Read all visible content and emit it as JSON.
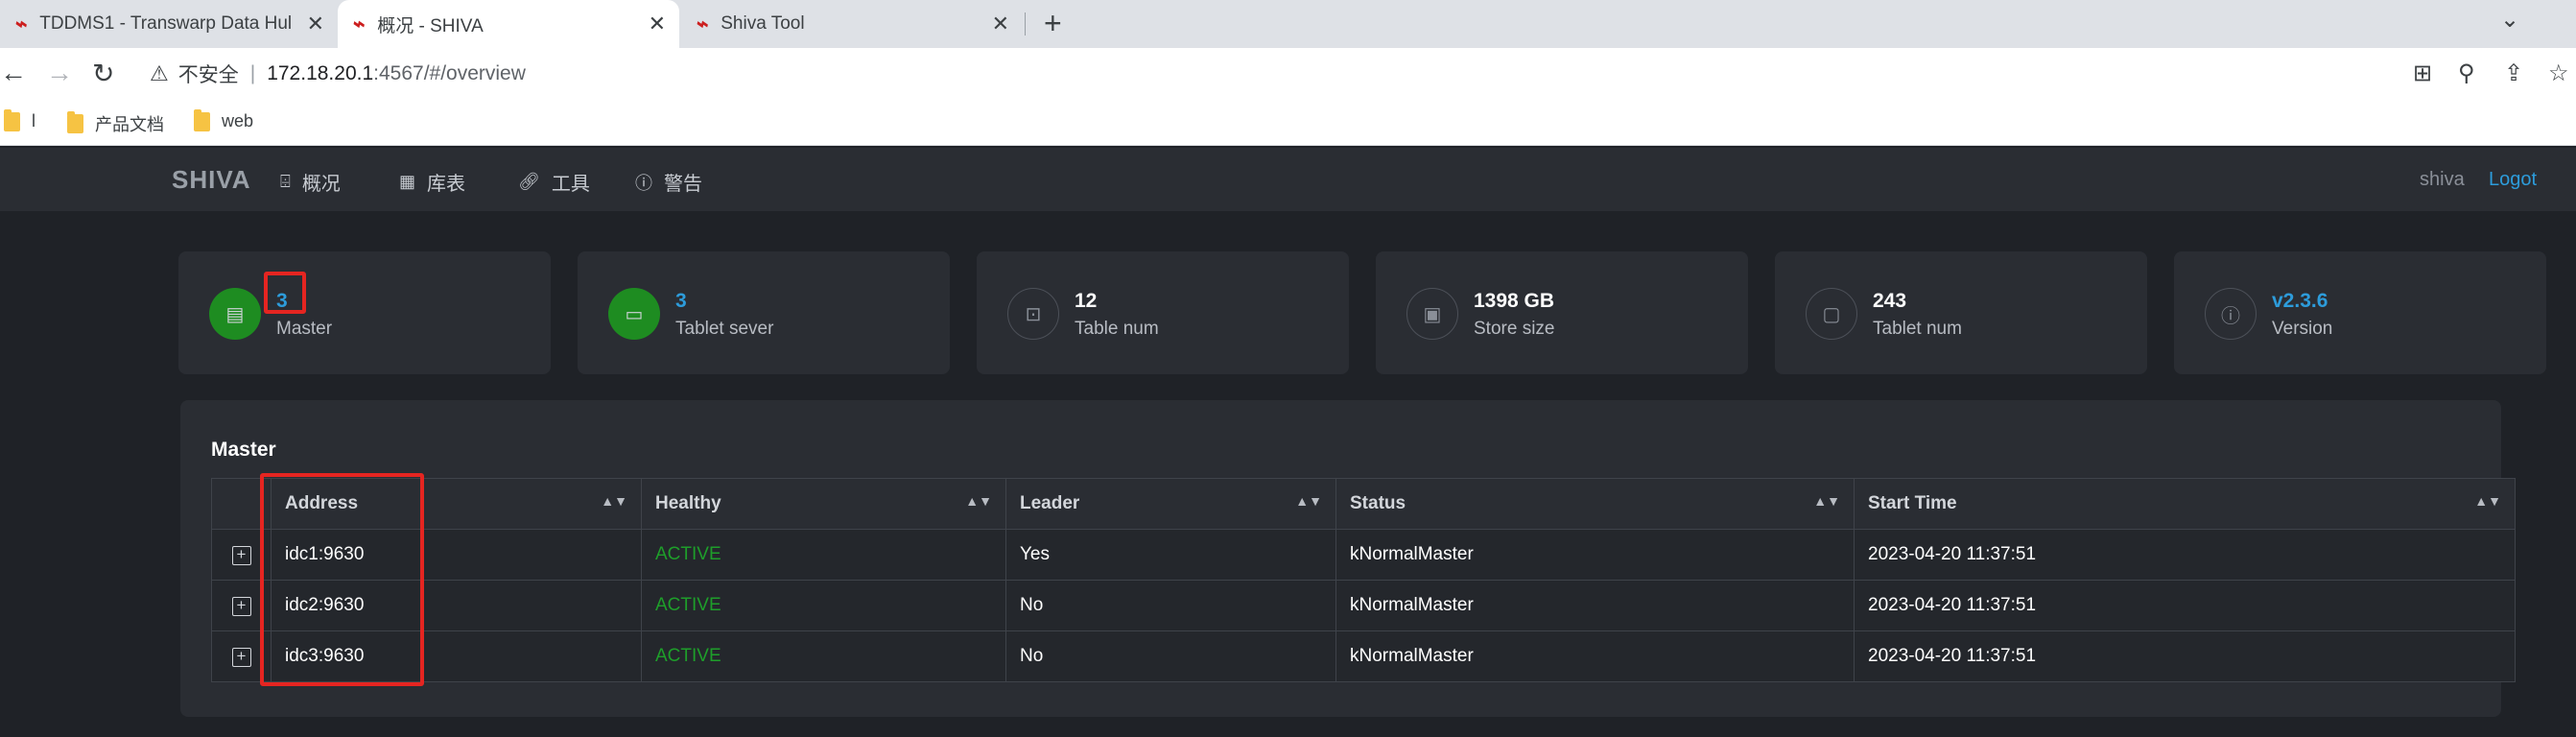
{
  "browser": {
    "tabs": [
      {
        "title": "TDDMS1 - Transwarp Data Hul"
      },
      {
        "title": "概况 - SHIVA"
      },
      {
        "title": "Shiva Tool"
      }
    ],
    "newtab": "+",
    "address": {
      "insecure_label": "不安全",
      "host": "172.18.20.1",
      "path": ":4567/#/overview"
    },
    "bookmarks": [
      {
        "label": "l"
      },
      {
        "label": "产品文档"
      },
      {
        "label": "web"
      }
    ]
  },
  "app": {
    "brand": "SHIVA",
    "menu": [
      {
        "label": "概况",
        "icon": "dashboard-icon"
      },
      {
        "label": "库表",
        "icon": "grid-icon"
      },
      {
        "label": "工具",
        "icon": "link-icon"
      },
      {
        "label": "警告",
        "icon": "info-icon"
      }
    ],
    "user": "shiva",
    "logout": "Logot"
  },
  "cards": [
    {
      "value": "3",
      "label": "Master",
      "icon": "server-icon"
    },
    {
      "value": "3",
      "label": "Tablet sever",
      "icon": "monitor-icon"
    },
    {
      "value": "12",
      "label": "Table num",
      "icon": "table-icon"
    },
    {
      "value": "1398 GB",
      "label": "Store size",
      "icon": "disk-icon"
    },
    {
      "value": "243",
      "label": "Tablet num",
      "icon": "tablet-icon"
    },
    {
      "value": "v2.3.6",
      "label": "Version",
      "icon": "version-icon"
    }
  ],
  "master": {
    "title": "Master",
    "columns": [
      "Address",
      "Healthy",
      "Leader",
      "Status",
      "Start Time"
    ],
    "rows": [
      {
        "address": "idc1:9630",
        "healthy": "ACTIVE",
        "leader": "Yes",
        "status": "kNormalMaster",
        "start_time": "2023-04-20 11:37:51"
      },
      {
        "address": "idc2:9630",
        "healthy": "ACTIVE",
        "leader": "No",
        "status": "kNormalMaster",
        "start_time": "2023-04-20 11:37:51"
      },
      {
        "address": "idc3:9630",
        "healthy": "ACTIVE",
        "leader": "No",
        "status": "kNormalMaster",
        "start_time": "2023-04-20 11:37:51"
      }
    ]
  },
  "colors": {
    "accent_blue": "#2d9cdb",
    "status_green": "#1e8c21",
    "highlight_red": "#e52521"
  }
}
